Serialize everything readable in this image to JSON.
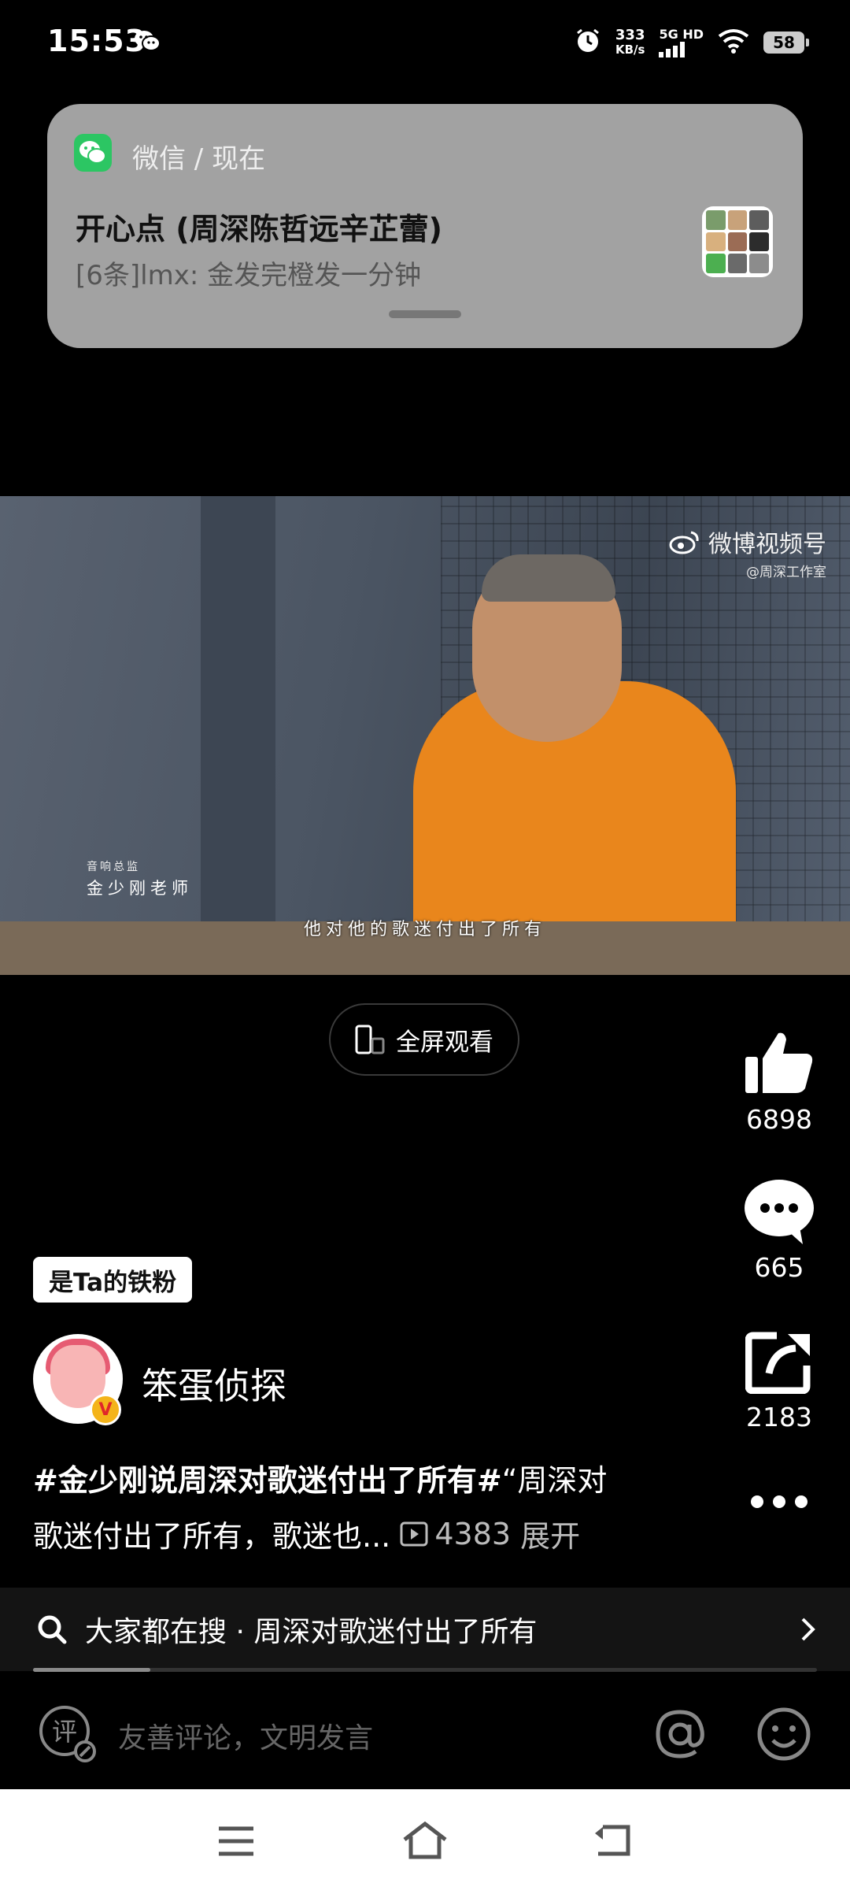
{
  "status_bar": {
    "time": "15:53",
    "speed_value": "333",
    "speed_unit": "KB/s",
    "network": "5G HD",
    "battery": "58"
  },
  "notification": {
    "app": "微信",
    "when": "现在",
    "app_line": "微信 / 现在",
    "title": "开心点 (周深陈哲远辛芷蕾)",
    "message": "[6条]lmx: 金发完橙发一分钟"
  },
  "video": {
    "watermark_main": "微博视频号",
    "watermark_sub": "@周深工作室",
    "caption_role": "音响总监",
    "caption_name": "金少刚老师",
    "subtitle": "他对他的歌迷付出了所有"
  },
  "fullscreen_button": {
    "label": "全屏观看"
  },
  "actions": {
    "like_count": "6898",
    "comment_count": "665",
    "share_count": "2183"
  },
  "fan_badge": "是Ta的铁粉",
  "author": {
    "name": "笨蛋侦探"
  },
  "description": {
    "hashtag": "#金少刚说周深对歌迷付出了所有#",
    "text_line1": "“周深对",
    "text_line2": "歌迷付出了所有，歌迷也...",
    "play_count": "4383",
    "expand": "展开"
  },
  "hot_search": {
    "text": "大家都在搜 · 周深对歌迷付出了所有",
    "progress": 0.15
  },
  "comment_input": {
    "placeholder": "友善评论，文明发言"
  },
  "icons": {
    "wechat": "wechat-icon",
    "alarm": "alarm-icon",
    "signal": "signal-icon",
    "wifi": "wifi-icon",
    "like": "thumbs-up-icon",
    "comment": "comment-bubble-icon",
    "share": "share-icon",
    "more": "more-dots-icon",
    "search": "search-icon",
    "chevron": "chevron-right-icon",
    "at": "at-icon",
    "emoji": "emoji-icon",
    "menu": "menu-icon",
    "home": "home-icon",
    "back": "back-icon"
  },
  "colors": {
    "background": "#000000",
    "notification_bg": "#a2a2a2",
    "wechat_green": "#2cc663",
    "shirt_orange": "#e9861c",
    "verified_badge": "#f4b41a"
  }
}
